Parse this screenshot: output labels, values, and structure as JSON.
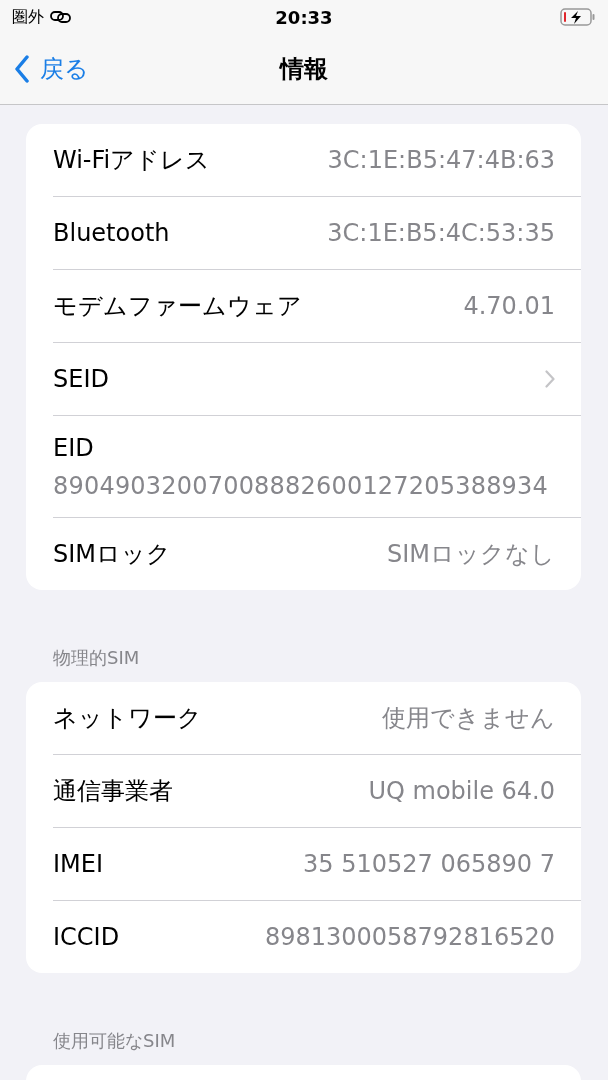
{
  "status_bar": {
    "carrier": "圏外",
    "time": "20:33"
  },
  "nav": {
    "back": "戻る",
    "title": "情報"
  },
  "sections": [
    {
      "rows": [
        {
          "kind": "value",
          "label": "Wi-Fiアドレス",
          "value": "3C:1E:B5:47:4B:63"
        },
        {
          "kind": "value",
          "label": "Bluetooth",
          "value": "3C:1E:B5:4C:53:35"
        },
        {
          "kind": "value",
          "label": "モデムファームウェア",
          "value": "4.70.01"
        },
        {
          "kind": "chevron",
          "label": "SEID"
        },
        {
          "kind": "stacked",
          "label": "EID",
          "value": "89049032007008882600127205388934"
        },
        {
          "kind": "value",
          "label": "SIMロック",
          "value": "SIMロックなし"
        }
      ]
    },
    {
      "header": "物理的SIM",
      "rows": [
        {
          "kind": "value",
          "label": "ネットワーク",
          "value": "使用できません"
        },
        {
          "kind": "value",
          "label": "通信事業者",
          "value": "UQ mobile 64.0"
        },
        {
          "kind": "value",
          "label": "IMEI",
          "value": "35 510527 065890 7"
        },
        {
          "kind": "value",
          "label": "ICCID",
          "value": "8981300058792816520"
        }
      ]
    },
    {
      "header": "使用可能なSIM"
    }
  ]
}
